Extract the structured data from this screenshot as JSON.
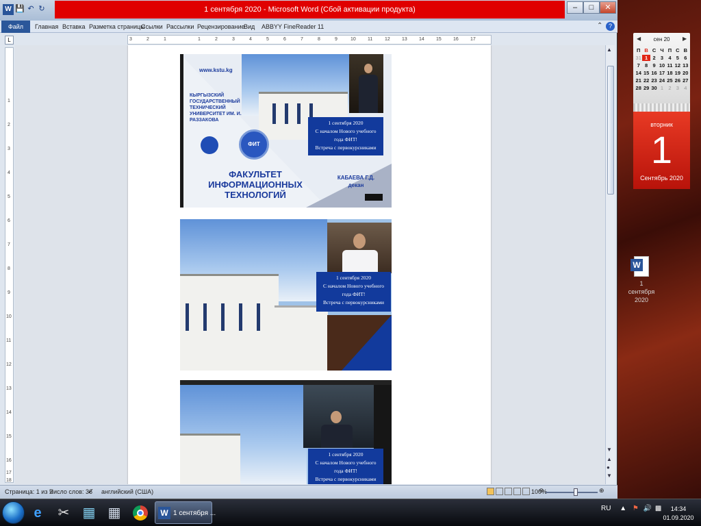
{
  "window": {
    "title": "1 сентября 2020 - Microsoft Word (Сбой активации продукта)",
    "logo_letter": "W"
  },
  "ribbon": {
    "file_tab": "Файл",
    "tabs": [
      "Главная",
      "Вставка",
      "Разметка страницы",
      "Ссылки",
      "Рассылки",
      "Рецензирование",
      "Вид",
      "ABBYY FineReader 11"
    ]
  },
  "ruler": {
    "corner": "L",
    "h_numbers": [
      "3",
      "2",
      "1",
      "1",
      "2",
      "3",
      "4",
      "5",
      "6",
      "7",
      "8",
      "9",
      "10",
      "11",
      "12",
      "13",
      "14",
      "15",
      "16",
      "17"
    ],
    "v_numbers": [
      "1",
      "2",
      "3",
      "4",
      "5",
      "6",
      "7",
      "8",
      "9",
      "10",
      "11",
      "12",
      "13",
      "14",
      "15",
      "16",
      "17",
      "18"
    ]
  },
  "slide1": {
    "website": "www.kstu.kg",
    "university": "КЫРГЫЗСКИЙ ГОСУДАРСТВЕННЫЙ ТЕХНИЧЕСКИЙ УНИВЕРСИТЕТ ИМ. И. РАЗЗАКОВА",
    "faculty_line1": "ФАКУЛЬТЕТ",
    "faculty_line2": "ИНФОРМАЦИОННЫХ",
    "faculty_line3": "ТЕХНОЛОГИЙ",
    "speaker_name": "КАБАЕВА Г.Д.",
    "speaker_role": "декан",
    "logo_label": "ФИТ"
  },
  "banner": {
    "date": "1 сентября 2020",
    "line2": "С началом Нового учебного",
    "line3": "года ФИТ!",
    "line4": "Встреча с первокурсниками"
  },
  "slide2": {
    "banner": {
      "date": "1 сентября 2020",
      "line2": "С началом Нового учебного",
      "line3": "года ФИТ!",
      "line4": "Встреча с первокурсниками"
    }
  },
  "slide3": {
    "banner": {
      "date": "1 сентября 2020",
      "line2": "С началом Нового учебного",
      "line3": "года ФИТ!",
      "line4": "Встреча с первокурсниками"
    }
  },
  "statusbar": {
    "page": "Страница: 1 из 2",
    "words": "Число слов: 36",
    "language": "английский (США)",
    "zoom": "100%"
  },
  "calendar": {
    "month_header": "сен 20",
    "weekdays": [
      "П",
      "В",
      "С",
      "Ч",
      "П",
      "С",
      "В"
    ],
    "weeks": [
      [
        "31",
        "1",
        "2",
        "3",
        "4",
        "5",
        "6"
      ],
      [
        "7",
        "8",
        "9",
        "10",
        "11",
        "12",
        "13"
      ],
      [
        "14",
        "15",
        "16",
        "17",
        "18",
        "19",
        "20"
      ],
      [
        "21",
        "22",
        "23",
        "24",
        "25",
        "26",
        "27"
      ],
      [
        "28",
        "29",
        "30",
        "1",
        "2",
        "3",
        "4"
      ]
    ],
    "weekday_name": "вторник",
    "day": "1",
    "month_year": "Сентябрь 2020"
  },
  "desktop_icon": {
    "label_line1": "1 сентября",
    "label_line2": "2020"
  },
  "taskbar": {
    "word_button": "1 сентября ...",
    "language": "RU",
    "time": "14:34",
    "date": "01.09.2020"
  },
  "colors": {
    "title_red": "#e00000",
    "banner_blue": "#123a9c",
    "calendar_red": "#e02515"
  }
}
